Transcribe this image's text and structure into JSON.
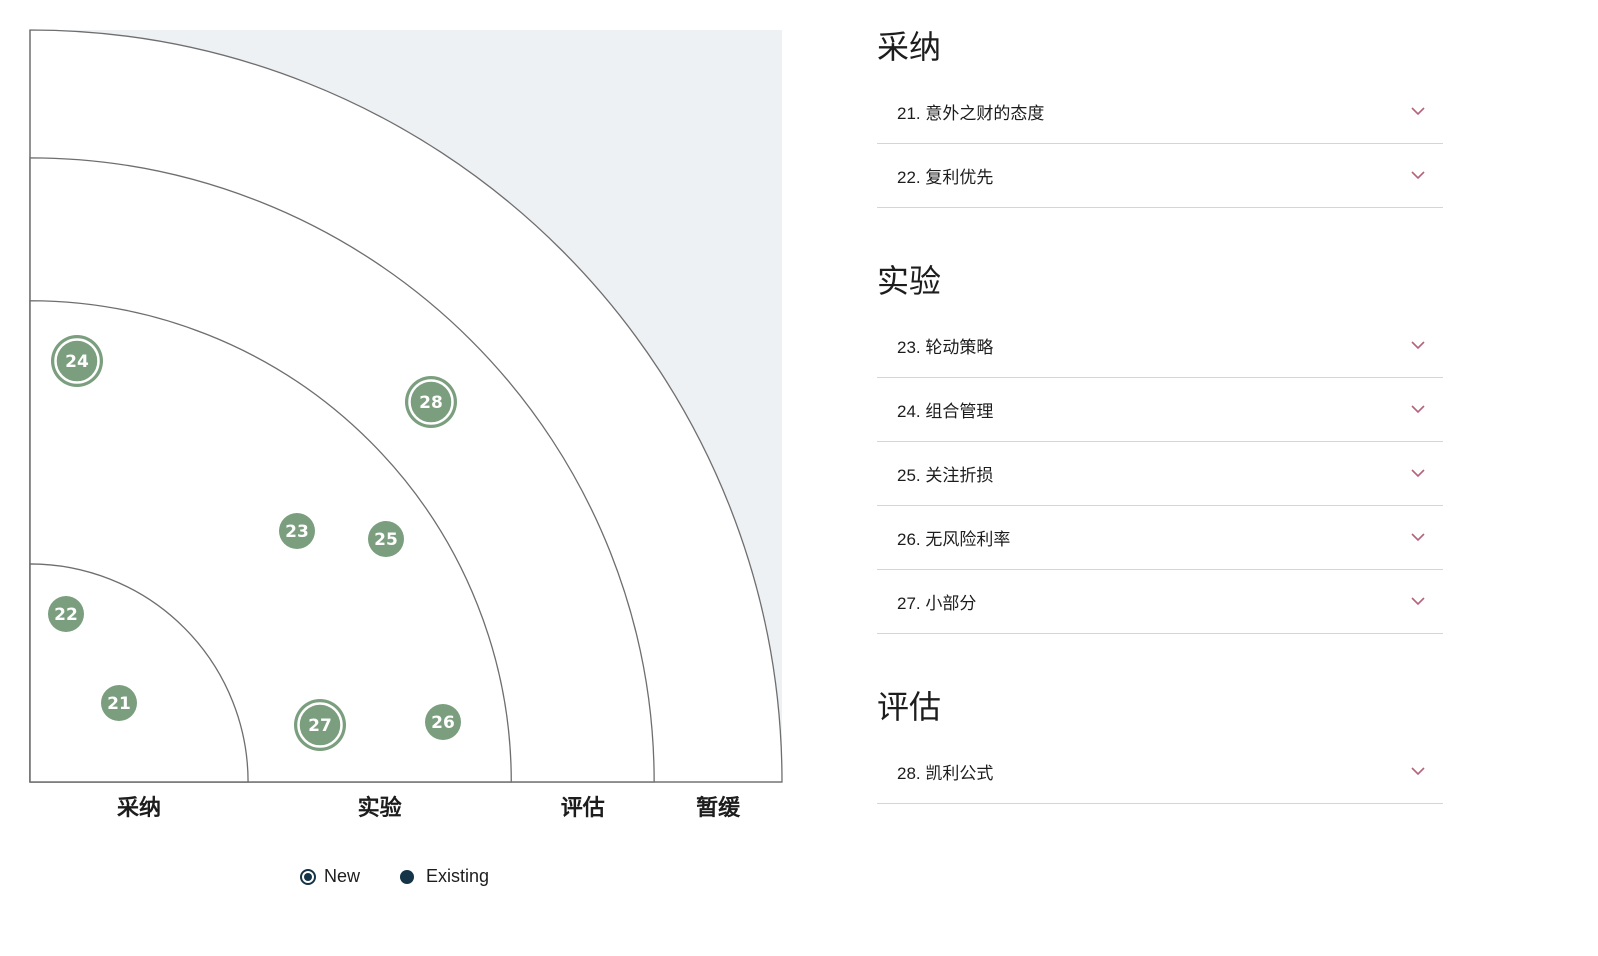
{
  "radar": {
    "ring_labels": [
      "采纳",
      "实验",
      "评估",
      "暂缓"
    ],
    "rings": [
      {
        "name": "采纳",
        "radius_fraction": 0.29
      },
      {
        "name": "实验",
        "radius_fraction": 0.64
      },
      {
        "name": "评估",
        "radius_fraction": 0.83
      },
      {
        "name": "暂缓",
        "radius_fraction": 1.0
      }
    ],
    "blips": [
      {
        "id": "21",
        "ring": "采纳",
        "is_new": false
      },
      {
        "id": "22",
        "ring": "采纳",
        "is_new": false
      },
      {
        "id": "23",
        "ring": "实验",
        "is_new": false
      },
      {
        "id": "24",
        "ring": "实验",
        "is_new": true
      },
      {
        "id": "25",
        "ring": "实验",
        "is_new": false
      },
      {
        "id": "26",
        "ring": "实验",
        "is_new": false
      },
      {
        "id": "27",
        "ring": "实验",
        "is_new": true
      },
      {
        "id": "28",
        "ring": "评估",
        "is_new": true
      }
    ],
    "colors": {
      "blip": "#7a9e7e",
      "background_outside": "#edf1f4",
      "ring_line": "#6e6e6e",
      "legend_icon": "#163447",
      "chevron": "#b4637a"
    }
  },
  "legend": {
    "new_label": "New",
    "existing_label": "Existing"
  },
  "sections": [
    {
      "heading": "采纳",
      "items": [
        {
          "label": "21. 意外之财的态度"
        },
        {
          "label": "22. 复利优先"
        }
      ]
    },
    {
      "heading": "实验",
      "items": [
        {
          "label": "23. 轮动策略"
        },
        {
          "label": "24. 组合管理"
        },
        {
          "label": "25. 关注折损"
        },
        {
          "label": "26. 无风险利率"
        },
        {
          "label": "27. 小部分"
        }
      ]
    },
    {
      "heading": "评估",
      "items": [
        {
          "label": "28. 凯利公式"
        }
      ]
    }
  ],
  "icons": {
    "chevron": "chevron-down-icon",
    "legend_new": "new-blip-icon",
    "legend_existing": "existing-blip-icon"
  }
}
